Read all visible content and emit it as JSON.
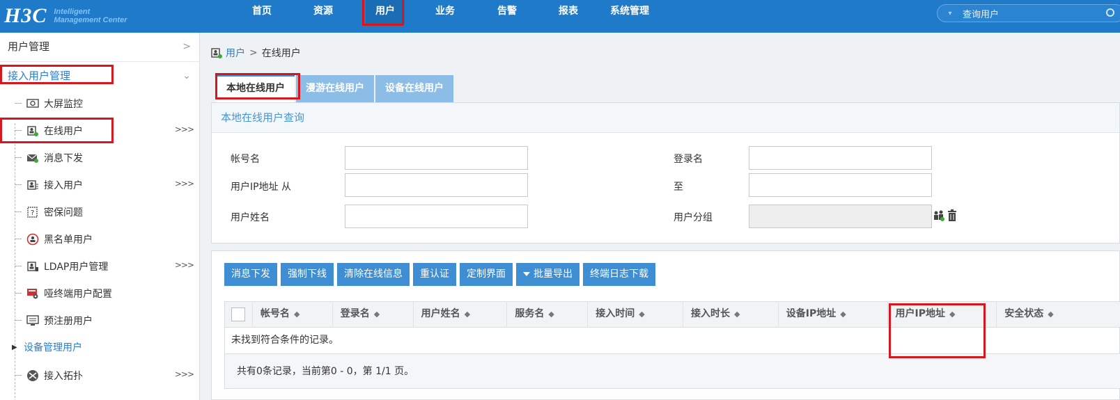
{
  "logo": {
    "mark": "H3C",
    "sub_line1": "Intelligent",
    "sub_line2": "Management Center"
  },
  "nav": [
    {
      "label": "首页"
    },
    {
      "label": "资源"
    },
    {
      "label": "用户"
    },
    {
      "label": "业务"
    },
    {
      "label": "告警"
    },
    {
      "label": "报表"
    },
    {
      "label": "系统管理"
    }
  ],
  "search": {
    "placeholder": "查询用户"
  },
  "sidebar": {
    "top": "用户管理",
    "group": "接入用户管理",
    "items": [
      {
        "label": "大屏监控",
        "icon": "monitor-icon"
      },
      {
        "label": "在线用户",
        "icon": "online-user-icon"
      },
      {
        "label": "消息下发",
        "icon": "message-icon"
      },
      {
        "label": "接入用户",
        "icon": "access-user-icon"
      },
      {
        "label": "密保问题",
        "icon": "question-icon"
      },
      {
        "label": "黑名单用户",
        "icon": "blacklist-icon"
      },
      {
        "label": "LDAP用户管理",
        "icon": "ldap-icon"
      },
      {
        "label": "哑终端用户配置",
        "icon": "dumb-terminal-icon"
      },
      {
        "label": "预注册用户",
        "icon": "preregister-icon"
      }
    ],
    "group2": "设备管理用户",
    "item_bottom": {
      "label": "接入拓扑",
      "icon": "topology-icon"
    },
    "more_glyph": ">>>"
  },
  "breadcrumb": {
    "parent": "用户",
    "sep": ">",
    "current": "在线用户"
  },
  "tabs": [
    {
      "label": "本地在线用户"
    },
    {
      "label": "漫游在线用户"
    },
    {
      "label": "设备在线用户"
    }
  ],
  "query": {
    "title": "本地在线用户查询",
    "account_label": "帐号名",
    "login_label": "登录名",
    "ip_from_label": "用户IP地址 从",
    "ip_to_label": "至",
    "name_label": "用户姓名",
    "group_label": "用户分组"
  },
  "toolbar": {
    "msg": "消息下发",
    "force_offline": "强制下线",
    "clear": "清除在线信息",
    "reauth": "重认证",
    "custom": "定制界面",
    "export": "批量导出",
    "log": "终端日志下载"
  },
  "table": {
    "columns": [
      "帐号名",
      "登录名",
      "用户姓名",
      "服务名",
      "接入时间",
      "接入时长",
      "设备IP地址",
      "用户IP地址",
      "安全状态"
    ],
    "empty": "未找到符合条件的记录。",
    "footer": "共有0条记录，当前第0 - 0，第 1/1 页。"
  },
  "colors": {
    "topbar": "#1f7ac9",
    "accent": "#3f8ed3",
    "highlight": "#d6171d"
  }
}
